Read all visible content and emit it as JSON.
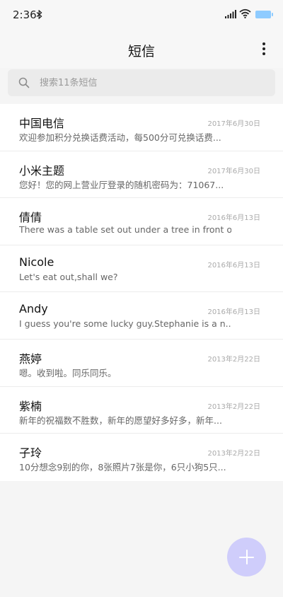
{
  "status_bar": {
    "time": "2:36",
    "icons": [
      "bluetooth-icon",
      "signal-icon",
      "wifi-icon",
      "battery-icon"
    ]
  },
  "header": {
    "title": "短信",
    "menu_icon": "more-vertical-icon"
  },
  "search": {
    "placeholder": "搜索11条短信",
    "icon": "search-icon"
  },
  "messages": [
    {
      "sender": "中国电信",
      "date": "2017年6月30日",
      "preview": "欢迎参加积分兑换话费活动，每500分可兑换话费..."
    },
    {
      "sender": "小米主题",
      "date": "2017年6月30日",
      "preview": "您好！您的网上营业厅登录的随机密码为：71067..."
    },
    {
      "sender": "倩倩",
      "date": "2016年6月13日",
      "preview": "There was a table set out under a tree in front o..."
    },
    {
      "sender": "Nicole",
      "date": "2016年6月13日",
      "preview": "Let's eat out,shall we?"
    },
    {
      "sender": "Andy",
      "date": "2016年6月13日",
      "preview": "I guess you're some lucky guy.Stephanie is a n..."
    },
    {
      "sender": "燕婷",
      "date": "2013年2月22日",
      "preview": "嗯。收到啦。同乐同乐。"
    },
    {
      "sender": "紫楠",
      "date": "2013年2月22日",
      "preview": "新年的祝福数不胜数，新年的愿望好多好多，新年..."
    },
    {
      "sender": "子玲",
      "date": "2013年2月22日",
      "preview": "10分想念9别的你，8张照片7张是你，6只小狗5只..."
    }
  ],
  "fab": {
    "icon": "plus-icon",
    "color": "#cfcdfb"
  },
  "colors": {
    "background": "#f5f5f5",
    "list_background": "#ffffff",
    "search_background": "#ebebeb",
    "battery": "#8ecbff"
  }
}
